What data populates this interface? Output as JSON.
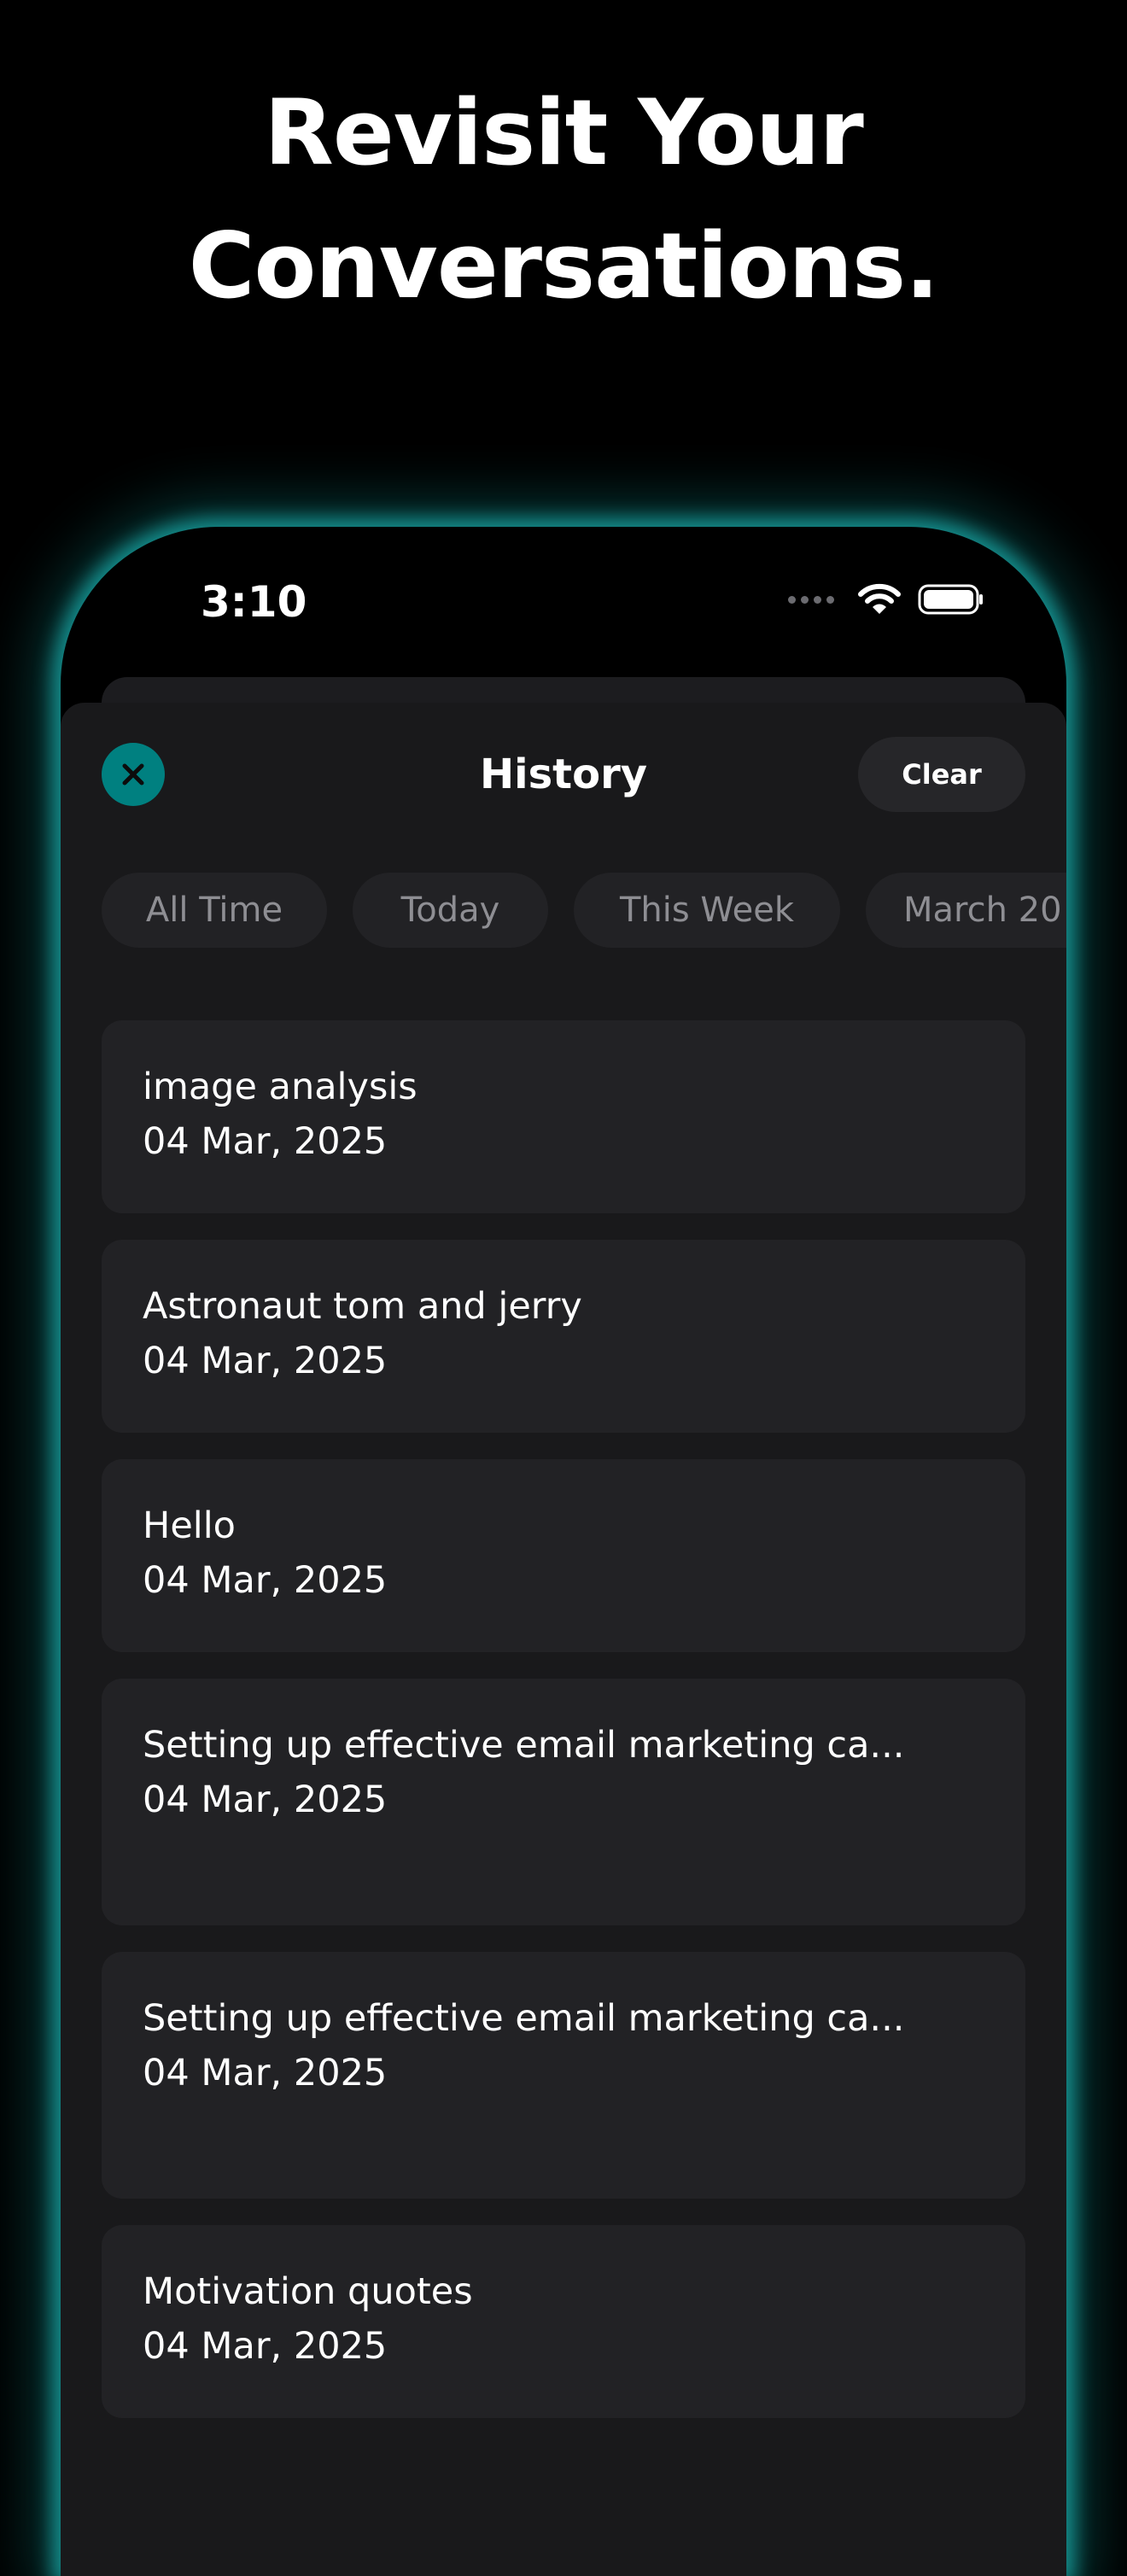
{
  "headline": {
    "line1": "Revisit Your",
    "line2": "Conversations."
  },
  "status_bar": {
    "time": "3:10",
    "icons": [
      "cellular-signal-icon",
      "wifi-icon",
      "battery-icon"
    ]
  },
  "history": {
    "title": "History",
    "clear_label": "Clear",
    "close_icon": "close-icon",
    "filters": [
      {
        "label": "All Time",
        "active": true
      },
      {
        "label": "Today",
        "active": false
      },
      {
        "label": "This Week",
        "active": false
      },
      {
        "label": "March 20",
        "active": false
      }
    ],
    "items": [
      {
        "title": "image analysis",
        "date": "04 Mar, 2025"
      },
      {
        "title": "Astronaut tom and jerry",
        "date": "04 Mar, 2025"
      },
      {
        "title": "Hello",
        "date": "04 Mar, 2025"
      },
      {
        "title": "Setting up effective email marketing ca...",
        "date": "04 Mar, 2025"
      },
      {
        "title": "Setting up effective email marketing ca...",
        "date": "04 Mar, 2025"
      },
      {
        "title": "Motivation quotes",
        "date": "04 Mar, 2025"
      }
    ]
  },
  "colors": {
    "background": "#000000",
    "accent": "#008080",
    "glow": "#189e9c",
    "sheet": "#19191b",
    "card": "#222225",
    "inactive_text": "#8e8e93"
  }
}
